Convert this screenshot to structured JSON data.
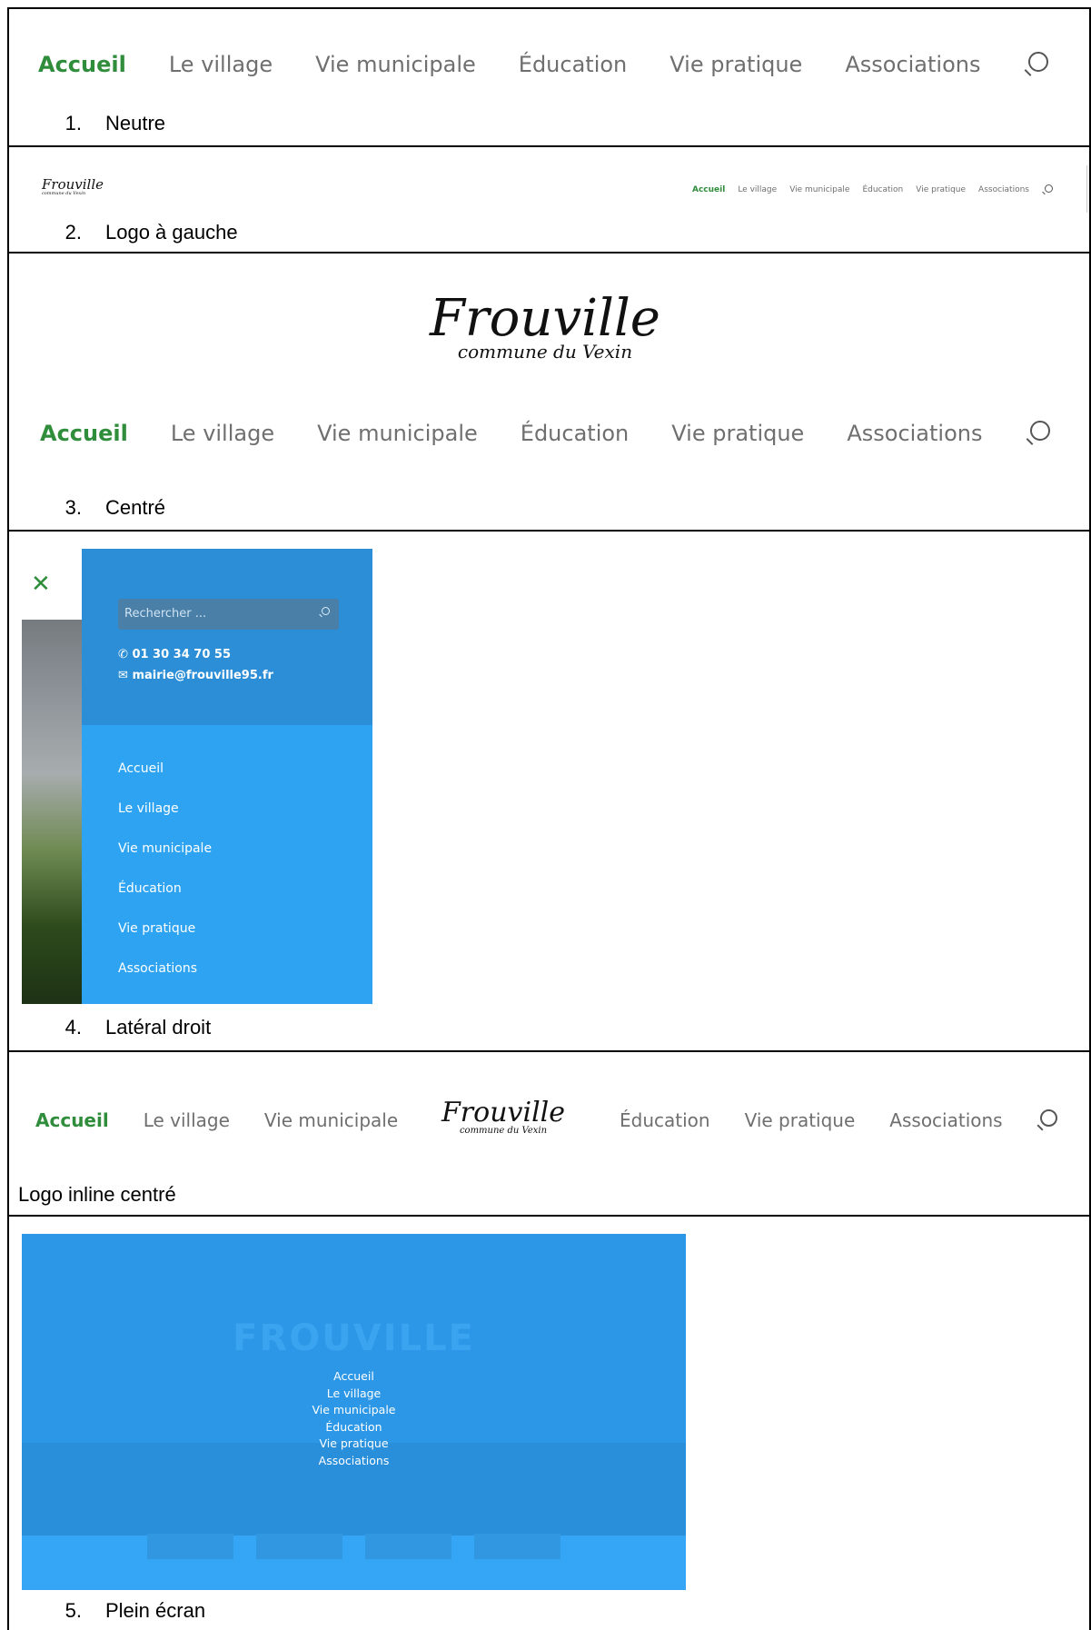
{
  "nav_items": [
    "Accueil",
    "Le village",
    "Vie municipale",
    "Éducation",
    "Vie pratique",
    "Associations"
  ],
  "logo": {
    "main": "Frouville",
    "sub": "commune du Vexin"
  },
  "sections": {
    "s1": {
      "num": "1.",
      "label": "Neutre"
    },
    "s2": {
      "num": "2.",
      "label": "Logo à gauche"
    },
    "s3": {
      "num": "3.",
      "label": "Centré"
    },
    "s4": {
      "num": "4.",
      "label": "Latéral droit"
    },
    "s_inline": {
      "label": "Logo inline centré"
    },
    "s5": {
      "num": "5.",
      "label": "Plein écran"
    }
  },
  "lateral": {
    "search_placeholder": "Rechercher ...",
    "phone": "01 30 34 70 55",
    "email": "mairie@frouville95.fr"
  },
  "fullscreen": {
    "ghost_title": "FROUVILLE"
  },
  "colors": {
    "active": "#2f8d3c",
    "inactive": "#6f6f6f",
    "panel_blue": "#2ea3f2",
    "panel_dark": "#2b8ed6"
  }
}
